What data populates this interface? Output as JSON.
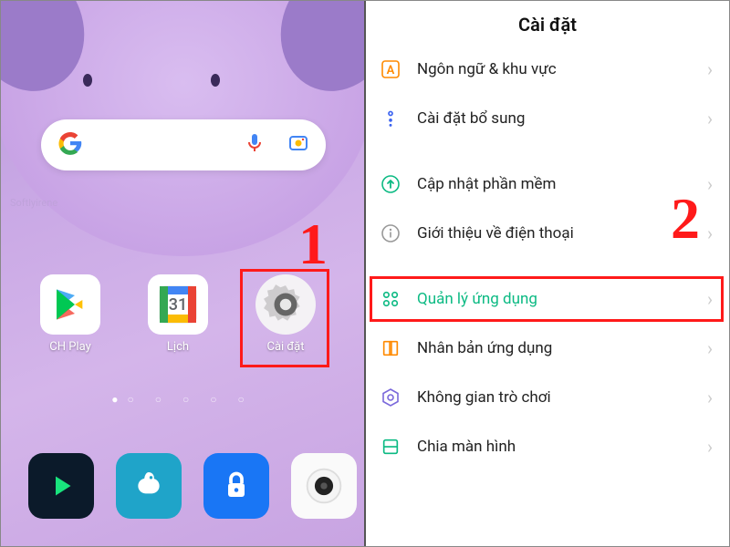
{
  "left": {
    "search_placeholder": "",
    "apps_row1": [
      {
        "label": "CH Play",
        "name": "play-store"
      },
      {
        "label": "Lịch",
        "name": "calendar",
        "badge": "31"
      },
      {
        "label": "Cài đặt",
        "name": "settings"
      }
    ],
    "dock": [
      "media-app",
      "bird-app",
      "lock-app",
      "camera-app"
    ],
    "step_label": "1",
    "signature": "Softlyirene"
  },
  "right": {
    "title": "Cài đặt",
    "items": [
      {
        "icon": "lang-a-icon",
        "label": "Ngôn ngữ & khu vực",
        "color": "#ff8a00"
      },
      {
        "icon": "more-dots-icon",
        "label": "Cài đặt bổ sung",
        "color": "#3a62f0"
      },
      {
        "_gap": true
      },
      {
        "icon": "update-arrow-icon",
        "label": "Cập nhật phần mềm",
        "color": "#0cba83"
      },
      {
        "icon": "info-icon",
        "label": "Giới thiệu về điện thoại",
        "color": "#888"
      },
      {
        "_gap": true
      },
      {
        "icon": "apps-grid-icon",
        "label": "Quản lý ứng dụng",
        "color": "#0cba83",
        "highlight": true,
        "green_text": true
      },
      {
        "icon": "clone-icon",
        "label": "Nhân bản ứng dụng",
        "color": "#ff8a00"
      },
      {
        "icon": "game-icon",
        "label": "Không gian trò chơi",
        "color": "#6b5bd4"
      },
      {
        "icon": "split-icon",
        "label": "Chia màn hình",
        "color": "#0cba83"
      }
    ],
    "step_label": "2"
  }
}
